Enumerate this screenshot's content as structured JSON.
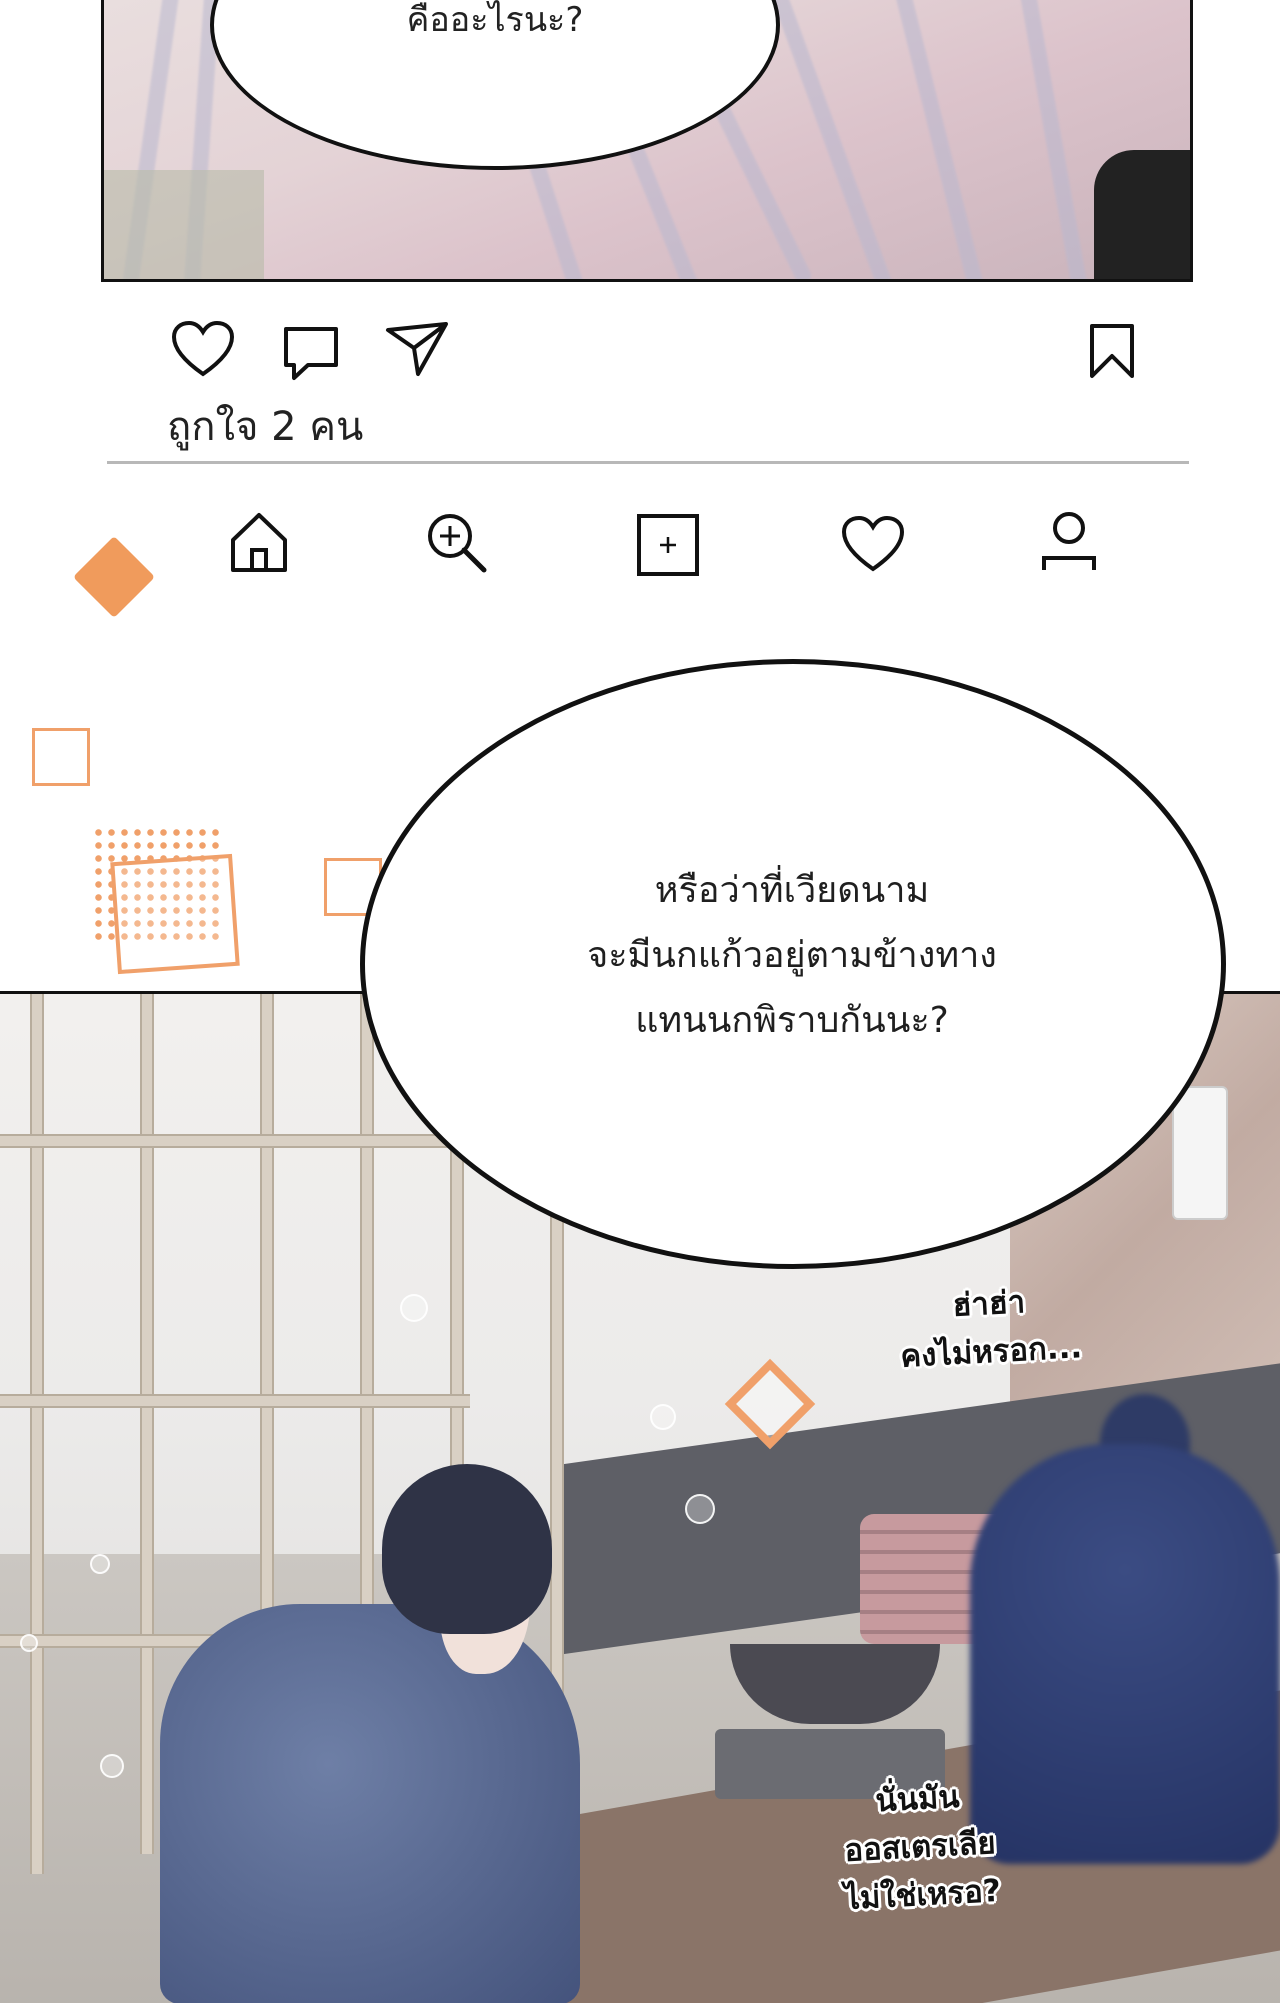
{
  "top_panel": {
    "bubble_text": "คืออะไรนะ?"
  },
  "post_actions": {
    "like_icon": "heart-outline-icon",
    "comment_icon": "speech-bubble-icon",
    "share_icon": "paper-plane-icon",
    "save_icon": "bookmark-icon",
    "likes_text": "ถูกใจ 2 คน"
  },
  "bottom_nav": {
    "items": [
      {
        "icon": "home-icon"
      },
      {
        "icon": "search-zoom-icon"
      },
      {
        "icon": "add-post-icon"
      },
      {
        "icon": "heart-icon"
      },
      {
        "icon": "profile-icon"
      }
    ]
  },
  "dialogue": {
    "line1": "หรือว่าที่เวียดนาม",
    "line2": "จะมีนกแก้วอยู่ตามข้างทาง",
    "line3": "แทนนกพิราบกันนะ?"
  },
  "sfx": {
    "haha_line1": "ฮ่าฮ่า",
    "haha_line2": "คงไม่หรอก...",
    "oyster_line1": "นั่นมัน",
    "oyster_line2": "ออสเตรเลีย",
    "oyster_line3": "ไม่ใช่เหรอ?"
  },
  "colors": {
    "accent": "#f09b5c",
    "ink": "#111111",
    "divider": "#b8b8b8"
  }
}
